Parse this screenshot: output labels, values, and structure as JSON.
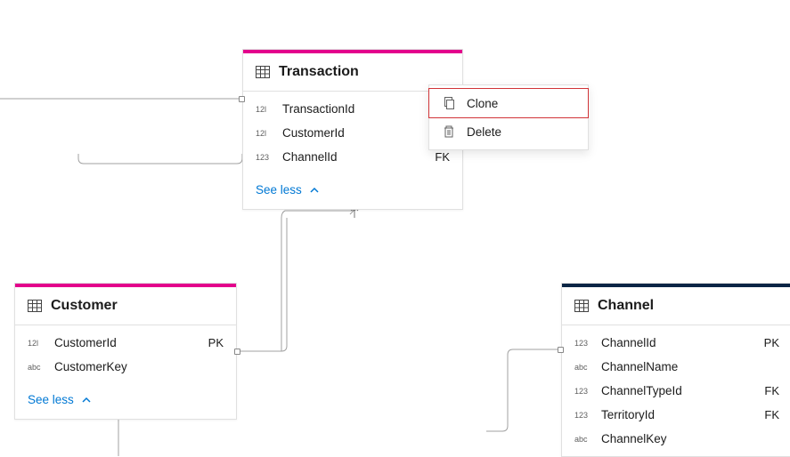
{
  "entities": {
    "transaction": {
      "title": "Transaction",
      "accent": "#E3008C",
      "columns": [
        {
          "type": "12l",
          "name": "TransactionId",
          "key": ""
        },
        {
          "type": "12l",
          "name": "CustomerId",
          "key": ""
        },
        {
          "type": "123",
          "name": "ChannelId",
          "key": "FK"
        }
      ],
      "see_less": "See less"
    },
    "customer": {
      "title": "Customer",
      "accent": "#E3008C",
      "columns": [
        {
          "type": "12l",
          "name": "CustomerId",
          "key": "PK"
        },
        {
          "type": "abc",
          "name": "CustomerKey",
          "key": ""
        }
      ],
      "see_less": "See less"
    },
    "channel": {
      "title": "Channel",
      "accent": "#0B2545",
      "columns": [
        {
          "type": "123",
          "name": "ChannelId",
          "key": "PK"
        },
        {
          "type": "abc",
          "name": "ChannelName",
          "key": ""
        },
        {
          "type": "123",
          "name": "ChannelTypeId",
          "key": "FK"
        },
        {
          "type": "123",
          "name": "TerritoryId",
          "key": "FK"
        },
        {
          "type": "abc",
          "name": "ChannelKey",
          "key": ""
        }
      ]
    }
  },
  "context_menu": {
    "clone": "Clone",
    "delete": "Delete"
  }
}
